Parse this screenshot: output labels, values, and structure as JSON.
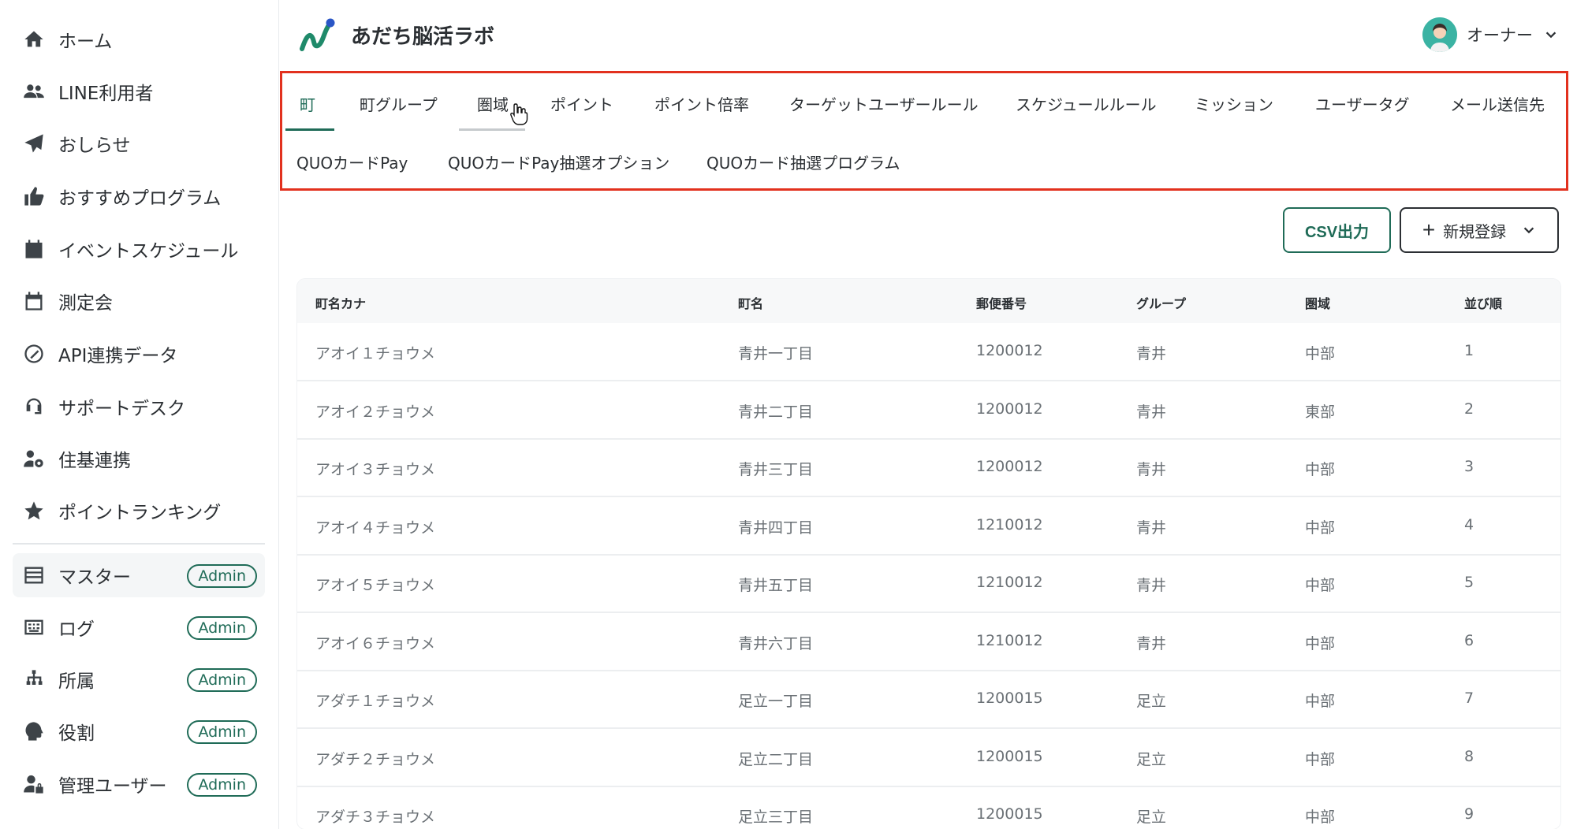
{
  "sidebar": {
    "items": [
      {
        "label": "ホーム",
        "icon": "home-icon"
      },
      {
        "label": "LINE利用者",
        "icon": "users-icon"
      },
      {
        "label": "おしらせ",
        "icon": "paper-plane-icon"
      },
      {
        "label": "おすすめプログラム",
        "icon": "thumbs-up-icon"
      },
      {
        "label": "イベントスケジュール",
        "icon": "calendar-icon"
      },
      {
        "label": "測定会",
        "icon": "calendar-blank-icon"
      },
      {
        "label": "API連携データ",
        "icon": "link-circle-icon"
      },
      {
        "label": "サポートデスク",
        "icon": "headset-icon"
      },
      {
        "label": "住基連携",
        "icon": "user-gear-icon"
      },
      {
        "label": "ポイントランキング",
        "icon": "star-icon"
      }
    ],
    "admin_items": [
      {
        "label": "マスター",
        "icon": "database-icon",
        "badge": "Admin",
        "active": true
      },
      {
        "label": "ログ",
        "icon": "keyboard-icon",
        "badge": "Admin"
      },
      {
        "label": "所属",
        "icon": "sitemap-icon",
        "badge": "Admin"
      },
      {
        "label": "役割",
        "icon": "head-icon",
        "badge": "Admin"
      },
      {
        "label": "管理ユーザー",
        "icon": "user-lock-icon",
        "badge": "Admin"
      }
    ]
  },
  "header": {
    "title": "あだち脳活ラボ",
    "user": "オーナー"
  },
  "tabs": {
    "row1": [
      "町",
      "町グループ",
      "圏域",
      "ポイント",
      "ポイント倍率",
      "ターゲットユーザールール",
      "スケジュールルール",
      "ミッション",
      "ユーザータグ",
      "メール送信先"
    ],
    "row2": [
      "QUOカードPay",
      "QUOカードPay抽選オプション",
      "QUOカード抽選プログラム"
    ],
    "active": "町"
  },
  "actions": {
    "csv_label": "CSV出力",
    "new_label": "新規登録"
  },
  "table": {
    "headers": [
      "町名カナ",
      "町名",
      "郵便番号",
      "グループ",
      "圏域",
      "並び順"
    ],
    "rows": [
      [
        "アオイ１チョウメ",
        "青井一丁目",
        "1200012",
        "青井",
        "中部",
        "1"
      ],
      [
        "アオイ２チョウメ",
        "青井二丁目",
        "1200012",
        "青井",
        "東部",
        "2"
      ],
      [
        "アオイ３チョウメ",
        "青井三丁目",
        "1200012",
        "青井",
        "中部",
        "3"
      ],
      [
        "アオイ４チョウメ",
        "青井四丁目",
        "1210012",
        "青井",
        "中部",
        "4"
      ],
      [
        "アオイ５チョウメ",
        "青井五丁目",
        "1210012",
        "青井",
        "中部",
        "5"
      ],
      [
        "アオイ６チョウメ",
        "青井六丁目",
        "1210012",
        "青井",
        "中部",
        "6"
      ],
      [
        "アダチ１チョウメ",
        "足立一丁目",
        "1200015",
        "足立",
        "中部",
        "7"
      ],
      [
        "アダチ２チョウメ",
        "足立二丁目",
        "1200015",
        "足立",
        "中部",
        "8"
      ],
      [
        "アダチ３チョウメ",
        "足立三丁目",
        "1200015",
        "足立",
        "中部",
        "9"
      ]
    ]
  },
  "colors": {
    "accent": "#1f6b57",
    "highlight_border": "#e2311e"
  }
}
